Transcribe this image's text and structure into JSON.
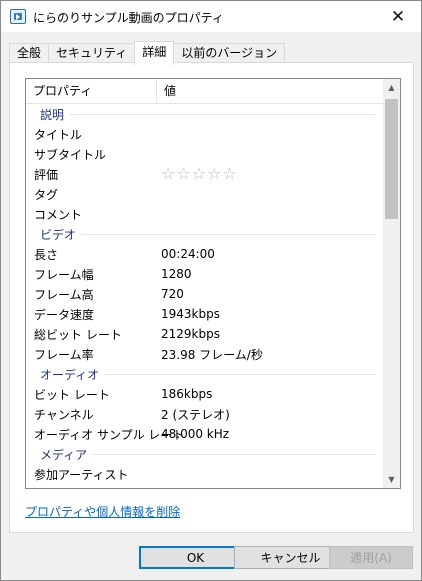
{
  "window": {
    "title": "にらのりサンプル動画のプロパティ",
    "close_glyph": "✕"
  },
  "tabs": [
    {
      "label": "全般",
      "active": false
    },
    {
      "label": "セキュリティ",
      "active": false
    },
    {
      "label": "詳細",
      "active": true
    },
    {
      "label": "以前のバージョン",
      "active": false
    }
  ],
  "list": {
    "header": {
      "property": "プロパティ",
      "value": "値"
    },
    "groups": [
      {
        "label": "説明",
        "rows": [
          {
            "key": "タイトル",
            "value": ""
          },
          {
            "key": "サブタイトル",
            "value": ""
          },
          {
            "key": "評価",
            "value": "☆☆☆☆☆",
            "rating": 0
          },
          {
            "key": "タグ",
            "value": ""
          },
          {
            "key": "コメント",
            "value": ""
          }
        ]
      },
      {
        "label": "ビデオ",
        "rows": [
          {
            "key": "長さ",
            "value": "00:24:00"
          },
          {
            "key": "フレーム幅",
            "value": "1280"
          },
          {
            "key": "フレーム高",
            "value": "720"
          },
          {
            "key": "データ速度",
            "value": "1943kbps"
          },
          {
            "key": "総ビット レート",
            "value": "2129kbps"
          },
          {
            "key": "フレーム率",
            "value": "23.98 フレーム/秒"
          }
        ]
      },
      {
        "label": "オーディオ",
        "rows": [
          {
            "key": "ビット レート",
            "value": "186kbps"
          },
          {
            "key": "チャンネル",
            "value": "2 (ステレオ)"
          },
          {
            "key": "オーディオ サンプル レート",
            "value": "48.000 kHz"
          }
        ]
      },
      {
        "label": "メディア",
        "rows": [
          {
            "key": "参加アーティスト",
            "value": ""
          }
        ]
      }
    ],
    "scrollbar": {
      "up_glyph": "▲",
      "down_glyph": "▼"
    }
  },
  "remove_link": "プロパティや個人情報を削除",
  "buttons": {
    "ok": "OK",
    "cancel": "キャンセル",
    "apply": "適用(A)"
  }
}
